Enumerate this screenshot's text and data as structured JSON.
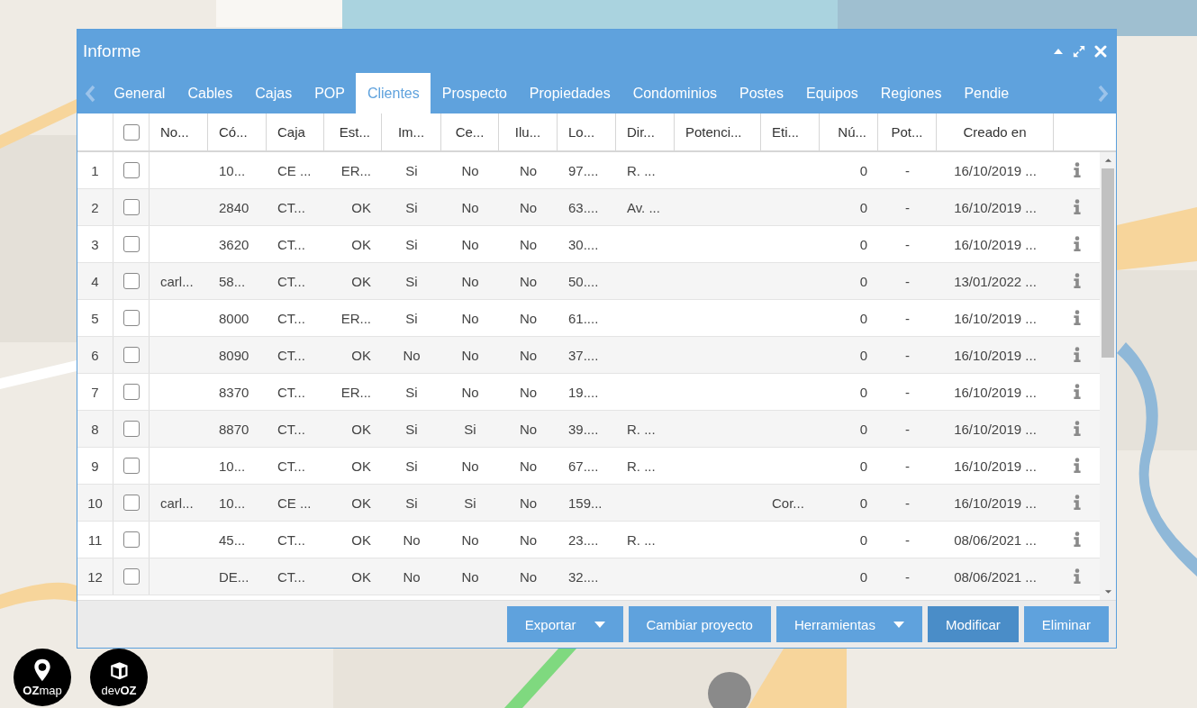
{
  "window": {
    "title": "Informe"
  },
  "tabs": [
    {
      "label": "General",
      "selected": false
    },
    {
      "label": "Cables",
      "selected": false
    },
    {
      "label": "Cajas",
      "selected": false
    },
    {
      "label": "POP",
      "selected": false
    },
    {
      "label": "Clientes",
      "selected": true
    },
    {
      "label": "Prospecto",
      "selected": false
    },
    {
      "label": "Propiedades",
      "selected": false
    },
    {
      "label": "Condominios",
      "selected": false
    },
    {
      "label": "Postes",
      "selected": false
    },
    {
      "label": "Equipos",
      "selected": false
    },
    {
      "label": "Regiones",
      "selected": false
    },
    {
      "label": "Pendie",
      "selected": false
    }
  ],
  "table": {
    "select_all": {
      "checked": false
    },
    "columns": [
      "No...",
      "Có...",
      "Caja",
      "Est...",
      "Im...",
      "Ce...",
      "Ilu...",
      "Lo...",
      "Dir...",
      "Potenci...",
      "Eti...",
      "Nú...",
      "Pot...",
      "Creado en"
    ],
    "rows": [
      {
        "number": "1",
        "checked": false,
        "cells": [
          null,
          "10...",
          "CE ...",
          "ER...",
          "Si",
          "No",
          "No",
          "97....",
          "R. ...",
          null,
          null,
          "0",
          "-",
          "16/10/2019 ..."
        ]
      },
      {
        "number": "2",
        "checked": false,
        "cells": [
          null,
          "2840",
          "CT...",
          "OK",
          "Si",
          "No",
          "No",
          "63....",
          "Av. ...",
          null,
          null,
          "0",
          "-",
          "16/10/2019 ..."
        ]
      },
      {
        "number": "3",
        "checked": false,
        "cells": [
          null,
          "3620",
          "CT...",
          "OK",
          "Si",
          "No",
          "No",
          "30....",
          null,
          null,
          null,
          "0",
          "-",
          "16/10/2019 ..."
        ]
      },
      {
        "number": "4",
        "checked": false,
        "cells": [
          "carl...",
          "58...",
          "CT...",
          "OK",
          "Si",
          "No",
          "No",
          "50....",
          null,
          null,
          null,
          "0",
          "-",
          "13/01/2022 ..."
        ]
      },
      {
        "number": "5",
        "checked": false,
        "cells": [
          null,
          "8000",
          "CT...",
          "ER...",
          "Si",
          "No",
          "No",
          "61....",
          null,
          null,
          null,
          "0",
          "-",
          "16/10/2019 ..."
        ]
      },
      {
        "number": "6",
        "checked": false,
        "cells": [
          null,
          "8090",
          "CT...",
          "OK",
          "No",
          "No",
          "No",
          "37....",
          null,
          null,
          null,
          "0",
          "-",
          "16/10/2019 ..."
        ]
      },
      {
        "number": "7",
        "checked": false,
        "cells": [
          null,
          "8370",
          "CT...",
          "ER...",
          "Si",
          "No",
          "No",
          "19....",
          null,
          null,
          null,
          "0",
          "-",
          "16/10/2019 ..."
        ]
      },
      {
        "number": "8",
        "checked": false,
        "cells": [
          null,
          "8870",
          "CT...",
          "OK",
          "Si",
          "Si",
          "No",
          "39....",
          "R. ...",
          null,
          null,
          "0",
          "-",
          "16/10/2019 ..."
        ]
      },
      {
        "number": "9",
        "checked": false,
        "cells": [
          null,
          "10...",
          "CT...",
          "OK",
          "Si",
          "No",
          "No",
          "67....",
          "R. ...",
          null,
          null,
          "0",
          "-",
          "16/10/2019 ..."
        ]
      },
      {
        "number": "10",
        "checked": false,
        "cells": [
          "carl...",
          "10...",
          "CE ...",
          "OK",
          "Si",
          "Si",
          "No",
          "159...",
          null,
          null,
          "Cor...",
          "0",
          "-",
          "16/10/2019 ..."
        ]
      },
      {
        "number": "11",
        "checked": false,
        "cells": [
          null,
          "45...",
          "CT...",
          "OK",
          "No",
          "No",
          "No",
          "23....",
          "R. ...",
          null,
          null,
          "0",
          "-",
          "08/06/2021 ..."
        ]
      },
      {
        "number": "12",
        "checked": false,
        "cells": [
          null,
          "DE...",
          "CT...",
          "OK",
          "No",
          "No",
          "No",
          "32....",
          null,
          null,
          null,
          "0",
          "-",
          "08/06/2021 ..."
        ]
      }
    ]
  },
  "buttons": [
    {
      "label": "Exportar",
      "kind": "dropdown",
      "selected": false
    },
    {
      "label": "Cambiar proyecto",
      "kind": "plain",
      "selected": false
    },
    {
      "label": "Herramientas",
      "kind": "dropdown",
      "selected": false
    },
    {
      "label": "Modificar",
      "kind": "plain",
      "selected": true
    },
    {
      "label": "Eliminar",
      "kind": "plain",
      "selected": false
    }
  ],
  "logos": [
    {
      "text": "**OZ**map",
      "kind": "pin"
    },
    {
      "text": "dev**OZ**",
      "kind": "box"
    }
  ]
}
